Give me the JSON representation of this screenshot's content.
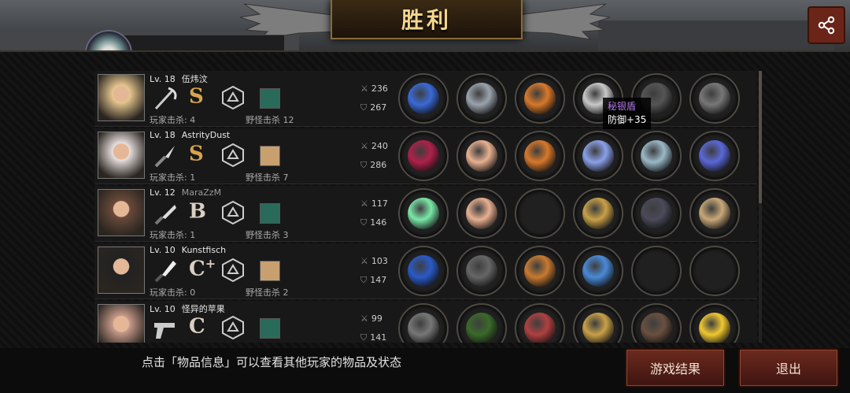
{
  "header": {
    "title": "胜利",
    "share_icon": "share-icon"
  },
  "tooltip": {
    "name": "秘银盾",
    "stat": "防御+35"
  },
  "players": [
    {
      "level": "Lv. 18",
      "name": "伍炜汶",
      "dim": false,
      "rank": "S",
      "rank_sup": "",
      "weapon": "scythe",
      "kills": "玩家击杀: 4",
      "monster_kills": "野怪击杀 12",
      "atk": "236",
      "def": "267",
      "items": [
        "blue-sword",
        "steel-helmet",
        "flame-armor",
        "silver-shield",
        "dark-boots",
        "black-blade"
      ]
    },
    {
      "level": "Lv. 18",
      "name": "AstrityDust",
      "dim": false,
      "rank": "S",
      "rank_sup": "",
      "weapon": "knife",
      "kills": "玩家击杀: 1",
      "monster_kills": "野怪击杀 7",
      "atk": "240",
      "def": "286",
      "items": [
        "crimson-sword",
        "wing-crown",
        "flame-armor",
        "crystal-gauntlet",
        "ice-boots",
        "galaxy-orb"
      ]
    },
    {
      "level": "Lv. 12",
      "name": "MaraZzM",
      "dim": true,
      "rank": "B",
      "rank_sup": "",
      "weapon": "machete",
      "kills": "玩家击杀: 1",
      "monster_kills": "野怪击杀 3",
      "atk": "117",
      "def": "146",
      "items": [
        "twin-green-blades",
        "wing-crown",
        "empty",
        "gold-shield",
        "shadow-gloves",
        "cardboard-box"
      ]
    },
    {
      "level": "Lv. 10",
      "name": "Kunstfisch",
      "dim": false,
      "rank": "C",
      "rank_sup": "+",
      "weapon": "kitchen-knife",
      "kills": "玩家击杀: 0",
      "monster_kills": "野怪击杀 2",
      "atk": "103",
      "def": "147",
      "items": [
        "blue-blade",
        "iron-helmet",
        "bronze-armor",
        "gem-bracelet",
        "empty",
        "empty"
      ]
    },
    {
      "level": "Lv. 10",
      "name": "怪异的苹果",
      "dim": false,
      "rank": "C",
      "rank_sup": "",
      "weapon": "pistol",
      "kills": "",
      "monster_kills": "",
      "atk": "99",
      "def": "141",
      "items": [
        "sniper-rifle",
        "green-beret",
        "red-armor",
        "gold-shield",
        "brown-boots",
        "yellow-lily"
      ]
    }
  ],
  "footer": {
    "hint": "点击「物品信息」可以查看其他玩家的物品及状态",
    "results_button": "游戏结果",
    "exit_button": "退出"
  },
  "colors": {
    "accent": "#6b2a1e",
    "title": "#f3d58c",
    "rank_s": "#d7a44c",
    "tooltip_name": "#b678e8"
  }
}
